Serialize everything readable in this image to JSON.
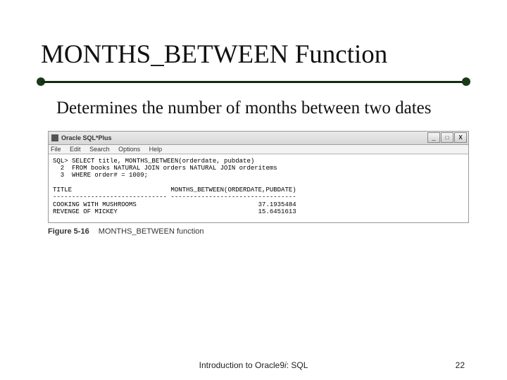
{
  "title": "MONTHS_BETWEEN Function",
  "body_text": "Determines the number of months between two dates",
  "window": {
    "title": "Oracle SQL*Plus",
    "min_glyph": "_",
    "max_glyph": "□",
    "close_glyph": "X"
  },
  "menu": {
    "file": "File",
    "edit": "Edit",
    "search": "Search",
    "options": "Options",
    "help": "Help"
  },
  "sql": {
    "line1": "SQL> SELECT title, MONTHS_BETWEEN(orderdate, pubdate)",
    "line2": "  2  FROM books NATURAL JOIN orders NATURAL JOIN orderitems",
    "line3": "  3  WHERE order# = 1009;",
    "blank": "",
    "header": "TITLE                          MONTHS_BETWEEN(ORDERDATE,PUBDATE)",
    "divider": "------------------------------ ---------------------------------",
    "row1": "COOKING WITH MUSHROOMS                                37.1935484",
    "row2": "REVENGE OF MICKEY                                     15.6451613"
  },
  "caption": {
    "label": "Figure 5-16",
    "text": "MONTHS_BETWEEN function"
  },
  "footer": {
    "center_prefix": "Introduction to Oracle9",
    "center_italic": "i",
    "center_suffix": ": SQL",
    "page": "22"
  }
}
